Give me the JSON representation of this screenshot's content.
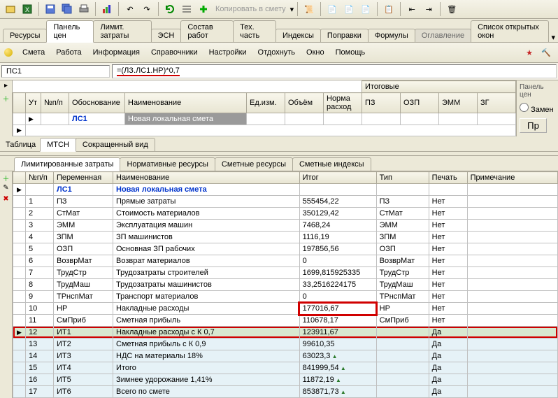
{
  "toolbar1": {
    "copy_label": "Копировать в смету"
  },
  "tabs1": [
    "Ресурсы",
    "Панель цен",
    "Лимит. затраты",
    "ЭСН",
    "Состав работ",
    "Тех. часть",
    "Индексы",
    "Поправки",
    "Формулы",
    "Оглавление",
    "Список открытых окон"
  ],
  "tabs1_active": 1,
  "tabs1_inactive": [
    9
  ],
  "menu": [
    "Смета",
    "Работа",
    "Информация",
    "Справочники",
    "Настройки",
    "Отдохнуть",
    "Окно",
    "Помощь"
  ],
  "formula": {
    "label": "ПС1",
    "value": "=(ЛЗ.ЛС1.НР)*0,7"
  },
  "upper_headers": [
    "Ут",
    "№п/п",
    "Обоснование",
    "Наименование",
    "Ед.изм.",
    "Объём",
    "Норма расход"
  ],
  "upper_group_header": "Итоговые",
  "upper_sub_headers": [
    "ПЗ",
    "ОЗП",
    "ЭММ",
    "ЗГ"
  ],
  "upper_row": {
    "obosn": "ЛС1",
    "naim": "Новая локальная смета"
  },
  "upper_tabs_left": "Таблица",
  "upper_tabs": [
    "МТСН",
    "Сокращенный вид"
  ],
  "right_panel": {
    "title": "Панель цен",
    "ck": "Замен",
    "btn": "Пр"
  },
  "lower_tabs": [
    "Лимитированные затраты",
    "Нормативные ресурсы",
    "Сметные ресурсы",
    "Сметные индексы"
  ],
  "lower_tabs_active": 0,
  "lower_headers": [
    "",
    "№п/п",
    "Переменная",
    "Наименование",
    "Итог",
    "Тип",
    "Печать",
    "Примечание"
  ],
  "lower_title_row": {
    "var": "ЛС1",
    "naim": "Новая локальная смета"
  },
  "lower_rows": [
    {
      "n": "1",
      "var": "ПЗ",
      "naim": "Прямые затраты",
      "itog": "555454,22",
      "tip": "ПЗ",
      "pech": "Нет"
    },
    {
      "n": "2",
      "var": "СтМат",
      "naim": "Стоимость материалов",
      "itog": "350129,42",
      "tip": "СтМат",
      "pech": "Нет"
    },
    {
      "n": "3",
      "var": "ЭММ",
      "naim": "Эксплуатация машин",
      "itog": "7468,24",
      "tip": "ЭММ",
      "pech": "Нет"
    },
    {
      "n": "4",
      "var": "ЗПМ",
      "naim": "ЗП машинистов",
      "itog": "1116,19",
      "tip": "ЗПМ",
      "pech": "Нет"
    },
    {
      "n": "5",
      "var": "ОЗП",
      "naim": "Основная ЗП рабочих",
      "itog": "197856,56",
      "tip": "ОЗП",
      "pech": "Нет"
    },
    {
      "n": "6",
      "var": "ВозврМат",
      "naim": "Возврат материалов",
      "itog": "0",
      "tip": "ВозврМат",
      "pech": "Нет"
    },
    {
      "n": "7",
      "var": "ТрудСтр",
      "naim": "Трудозатраты строителей",
      "itog": "1699,815925335",
      "tip": "ТрудСтр",
      "pech": "Нет"
    },
    {
      "n": "8",
      "var": "ТрудМаш",
      "naim": "Трудозатраты машинистов",
      "itog": "33,2516224175",
      "tip": "ТрудМаш",
      "pech": "Нет"
    },
    {
      "n": "9",
      "var": "ТРнспМат",
      "naim": "Транспорт материалов",
      "itog": "0",
      "tip": "ТРнспМат",
      "pech": "Нет"
    },
    {
      "n": "10",
      "var": "НР",
      "naim": "Накладные расходы",
      "itog": "177016,67",
      "tip": "НР",
      "pech": "Нет",
      "hl_itog": true
    },
    {
      "n": "11",
      "var": "СмПриб",
      "naim": "Сметная прибыль",
      "itog": "110678,17",
      "tip": "СмПриб",
      "pech": "Нет"
    },
    {
      "n": "12",
      "var": "ИТ1",
      "naim": "Накладные расходы с К 0,7",
      "itog": "123911,67",
      "tip": "",
      "pech": "Да",
      "hl_row": true,
      "sel": true,
      "ptr": true
    },
    {
      "n": "13",
      "var": "ИТ2",
      "naim": "Сметная прибыль с К 0,9",
      "itog": "99610,35",
      "tip": "",
      "pech": "Да",
      "alt": true
    },
    {
      "n": "14",
      "var": "ИТ3",
      "naim": "НДС на материалы  18%",
      "itog": "63023,3",
      "tip": "",
      "pech": "Да",
      "alt": true,
      "tri": true
    },
    {
      "n": "15",
      "var": "ИТ4",
      "naim": "Итого",
      "itog": "841999,54",
      "tip": "",
      "pech": "Да",
      "alt": true,
      "tri": true
    },
    {
      "n": "16",
      "var": "ИТ5",
      "naim": "Зимнее удорожание 1,41%",
      "itog": "11872,19",
      "tip": "",
      "pech": "Да",
      "alt": true,
      "tri": true
    },
    {
      "n": "17",
      "var": "ИТ6",
      "naim": "Всего по смете",
      "itog": "853871,73",
      "tip": "",
      "pech": "Да",
      "alt": true,
      "tri": true
    }
  ]
}
